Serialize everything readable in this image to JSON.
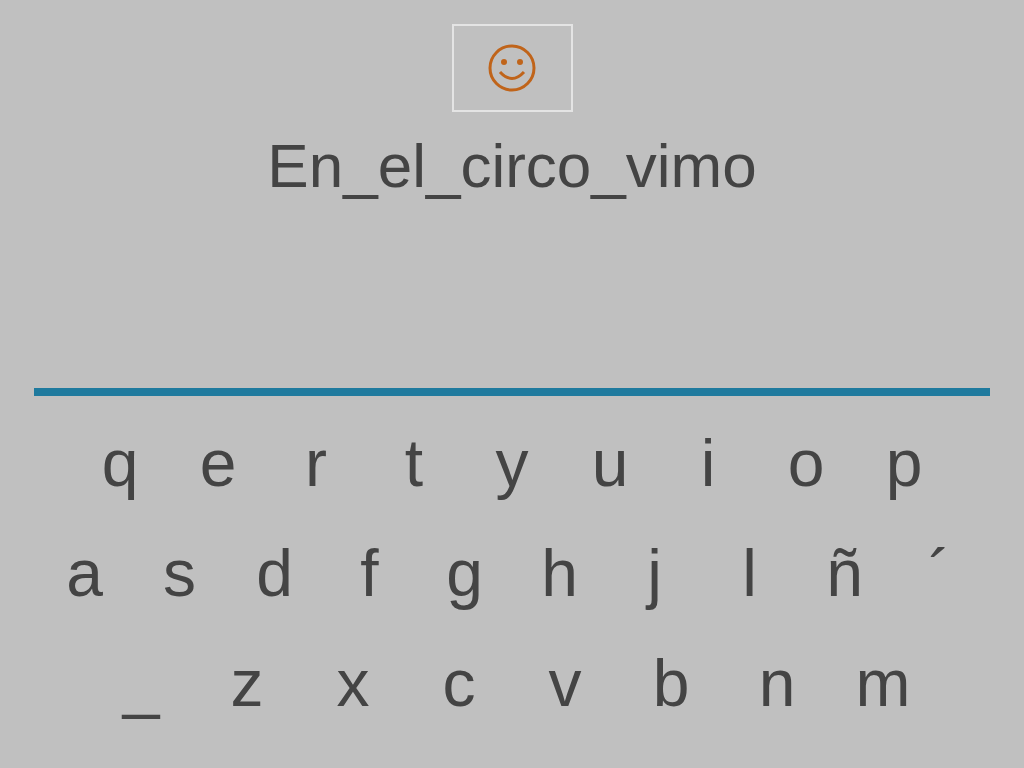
{
  "prompt": "En_el_circo_vimo",
  "keyboard": {
    "rows": [
      {
        "keys": [
          "q",
          "e",
          "r",
          "t",
          "y",
          "u",
          "i",
          "o",
          "p"
        ]
      },
      {
        "keys": [
          "a",
          "s",
          "d",
          "f",
          "g",
          "h",
          "j",
          "l",
          "ñ",
          "´"
        ]
      },
      {
        "keys": [
          "_",
          "z",
          "x",
          "c",
          "v",
          "b",
          "n",
          "m"
        ]
      }
    ]
  }
}
